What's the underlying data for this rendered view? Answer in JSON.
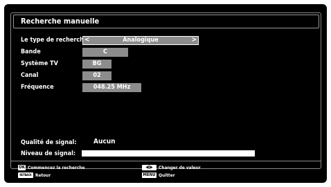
{
  "title": "Recherche manuelle",
  "fields": {
    "search_type": {
      "label": "Le type de recherche",
      "value": "Analogique"
    },
    "band": {
      "label": "Bande",
      "value": "C"
    },
    "tv_system": {
      "label": "Système TV",
      "value": "BG"
    },
    "channel": {
      "label": "Canal",
      "value": "02"
    },
    "frequency": {
      "label": "Fréquence",
      "value": "048.25 MHz"
    }
  },
  "signal": {
    "quality_label": "Qualité de signal:",
    "quality_value": "Aucun",
    "level_label": "Niveau de signal:"
  },
  "footer": {
    "ok_key": "OK",
    "ok_hint": "Commencez la recherche",
    "back_key": "RETBACK",
    "back_hint": "Retour",
    "change_hint": "Changer de valeur",
    "menu_key": "MENU",
    "menu_hint": "Quitter"
  },
  "icons": {
    "left_arrow": "chevron-left-icon",
    "right_arrow": "chevron-right-icon"
  }
}
